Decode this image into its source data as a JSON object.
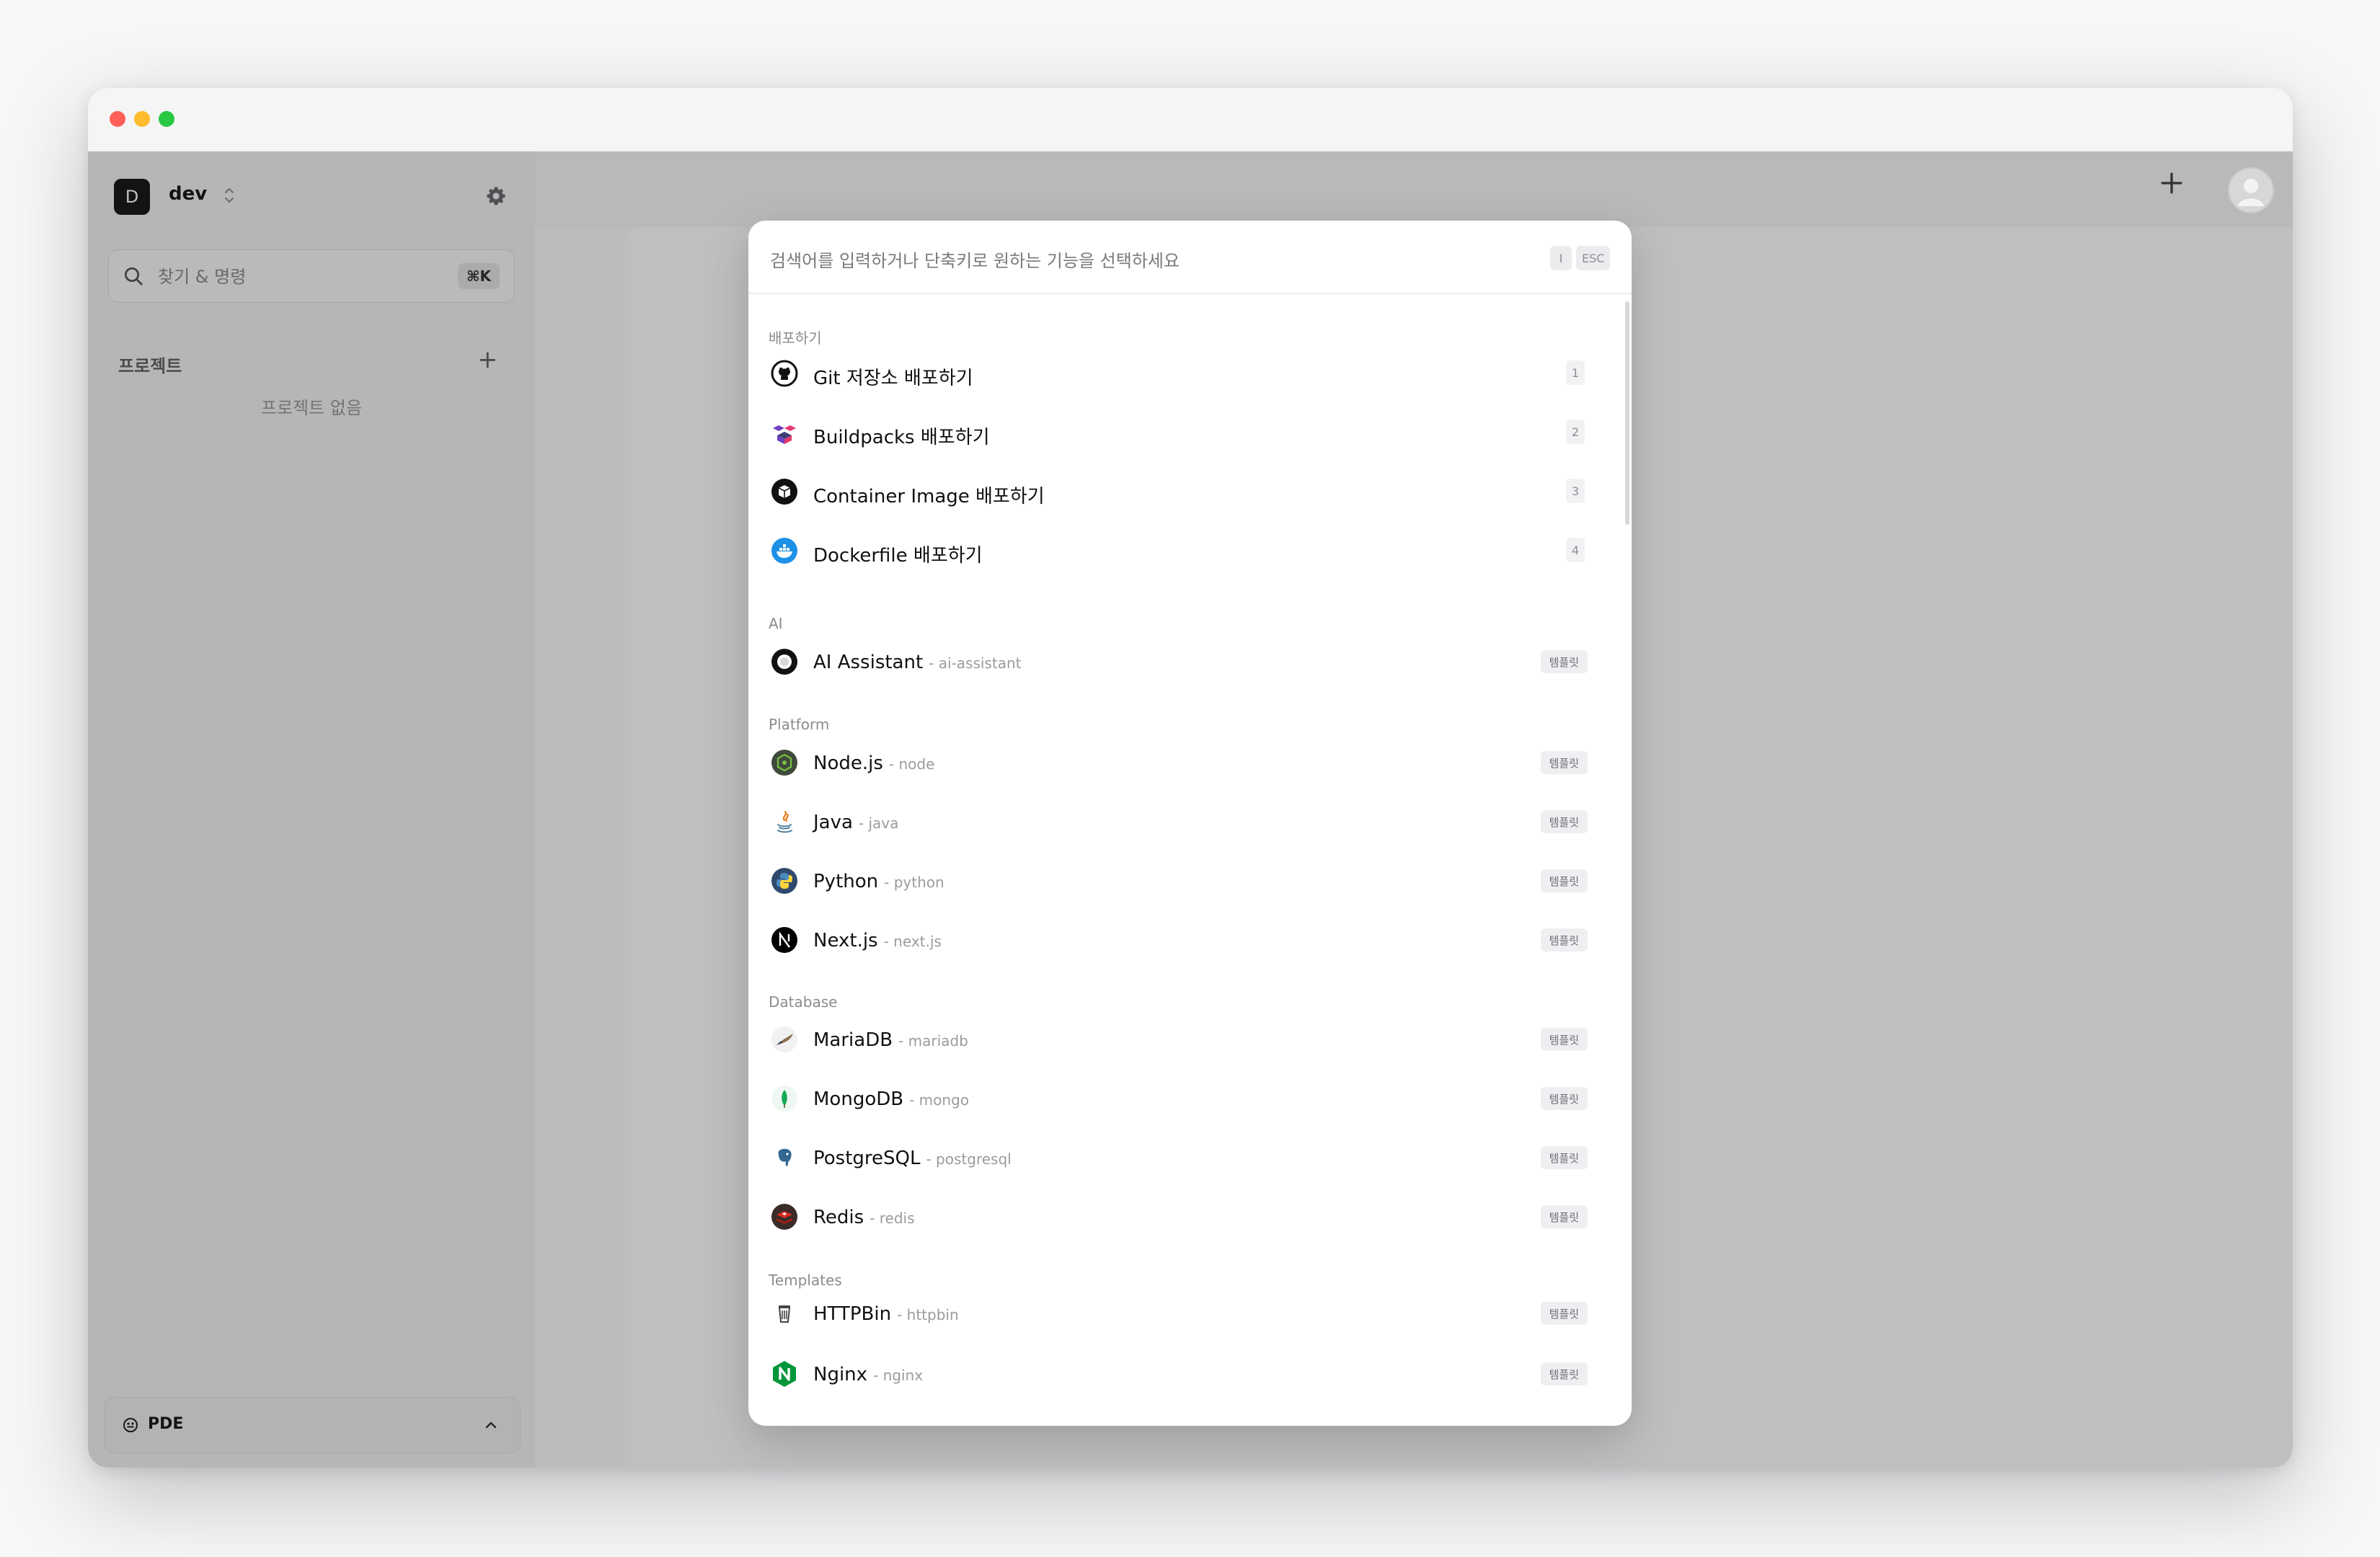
{
  "workspace": {
    "initial": "D",
    "name": "dev"
  },
  "sidebar": {
    "search_placeholder": "찾기 & 명령",
    "search_shortcut": "⌘K",
    "projects_title": "프로젝트",
    "projects_empty": "프로젝트 없음",
    "footer_label": "PDE"
  },
  "palette": {
    "placeholder": "검색어를 입력하거나 단축키로 원하는 기능을 선택하세요",
    "kbd_i": "I",
    "kbd_esc": "ESC",
    "sections": {
      "deploy": "배포하기",
      "ai": "AI",
      "platform": "Platform",
      "database": "Database",
      "templates": "Templates"
    },
    "template_badge": "템플릿",
    "items": [
      {
        "icon": "github-icon",
        "label": "Git 저장소 배포하기",
        "sub": "",
        "key": "1"
      },
      {
        "icon": "buildpacks-icon",
        "label": "Buildpacks 배포하기",
        "sub": "",
        "key": "2"
      },
      {
        "icon": "container-image-icon",
        "label": "Container Image 배포하기",
        "sub": "",
        "key": "3"
      },
      {
        "icon": "docker-icon",
        "label": "Dockerfile 배포하기",
        "sub": "",
        "key": "4"
      },
      {
        "icon": "ai-assistant-icon",
        "label": "AI Assistant",
        "sub": "- ai-assistant"
      },
      {
        "icon": "nodejs-icon",
        "label": "Node.js",
        "sub": "- node"
      },
      {
        "icon": "java-icon",
        "label": "Java",
        "sub": "- java"
      },
      {
        "icon": "python-icon",
        "label": "Python",
        "sub": "- python"
      },
      {
        "icon": "nextjs-icon",
        "label": "Next.js",
        "sub": "- next.js"
      },
      {
        "icon": "mariadb-icon",
        "label": "MariaDB",
        "sub": "- mariadb"
      },
      {
        "icon": "mongodb-icon",
        "label": "MongoDB",
        "sub": "- mongo"
      },
      {
        "icon": "postgresql-icon",
        "label": "PostgreSQL",
        "sub": "- postgresql"
      },
      {
        "icon": "redis-icon",
        "label": "Redis",
        "sub": "- redis"
      },
      {
        "icon": "httpbin-icon",
        "label": "HTTPBin",
        "sub": "- httpbin"
      },
      {
        "icon": "nginx-icon",
        "label": "Nginx",
        "sub": "- nginx"
      }
    ]
  }
}
